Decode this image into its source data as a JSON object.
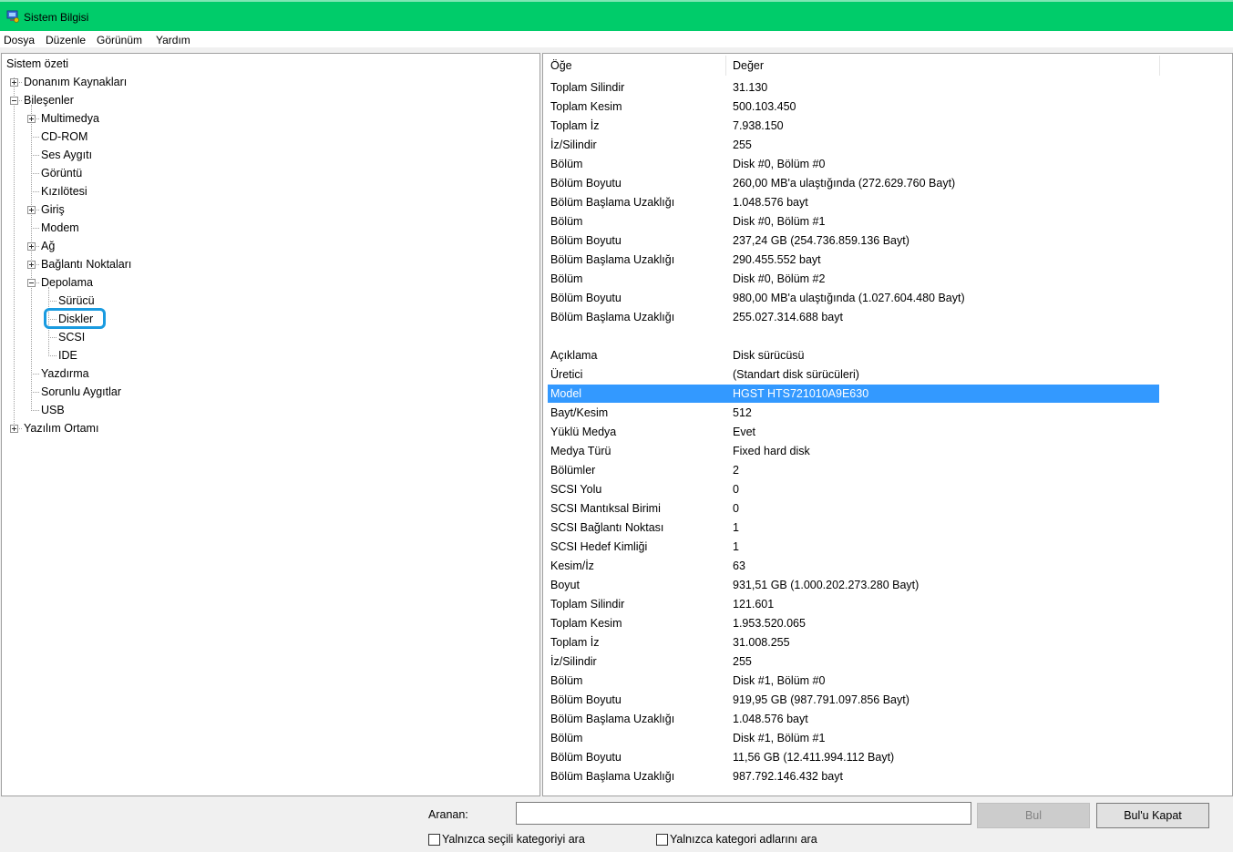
{
  "window": {
    "title": "Sistem Bilgisi",
    "icon": "system-info-icon"
  },
  "menu": [
    "Dosya",
    "Düzenle",
    "Görünüm",
    "Yardım"
  ],
  "tree": {
    "root": "Sistem özeti",
    "nodes": [
      {
        "label": "Donanım Kaynakları",
        "level": 1,
        "expander": "plus"
      },
      {
        "label": "Bileşenler",
        "level": 1,
        "expander": "minus"
      },
      {
        "label": "Multimedya",
        "level": 2,
        "expander": "plus"
      },
      {
        "label": "CD-ROM",
        "level": 2,
        "expander": "none"
      },
      {
        "label": "Ses Aygıtı",
        "level": 2,
        "expander": "none"
      },
      {
        "label": "Görüntü",
        "level": 2,
        "expander": "none"
      },
      {
        "label": "Kızılötesi",
        "level": 2,
        "expander": "none"
      },
      {
        "label": "Giriş",
        "level": 2,
        "expander": "plus"
      },
      {
        "label": "Modem",
        "level": 2,
        "expander": "none"
      },
      {
        "label": "Ağ",
        "level": 2,
        "expander": "plus"
      },
      {
        "label": "Bağlantı Noktaları",
        "level": 2,
        "expander": "plus"
      },
      {
        "label": "Depolama",
        "level": 2,
        "expander": "minus"
      },
      {
        "label": "Sürücü",
        "level": 3,
        "expander": "none"
      },
      {
        "label": "Diskler",
        "level": 3,
        "expander": "none",
        "selected": true
      },
      {
        "label": "SCSI",
        "level": 3,
        "expander": "none"
      },
      {
        "label": "IDE",
        "level": 3,
        "expander": "none"
      },
      {
        "label": "Yazdırma",
        "level": 2,
        "expander": "none"
      },
      {
        "label": "Sorunlu Aygıtlar",
        "level": 2,
        "expander": "none"
      },
      {
        "label": "USB",
        "level": 2,
        "expander": "none"
      },
      {
        "label": "Yazılım Ortamı",
        "level": 1,
        "expander": "plus"
      }
    ]
  },
  "list": {
    "columns": [
      "Öğe",
      "Değer"
    ],
    "selected_row": 17,
    "rows": [
      [
        "Toplam Silindir",
        "31.130"
      ],
      [
        "Toplam Kesim",
        "500.103.450"
      ],
      [
        "Toplam İz",
        "7.938.150"
      ],
      [
        "İz/Silindir",
        "255"
      ],
      [
        "Bölüm",
        "Disk #0, Bölüm #0"
      ],
      [
        "Bölüm Boyutu",
        "260,00 MB'a ulaştığında (272.629.760 Bayt)"
      ],
      [
        "Bölüm Başlama Uzaklığı",
        "1.048.576 bayt"
      ],
      [
        "Bölüm",
        "Disk #0, Bölüm #1"
      ],
      [
        "Bölüm Boyutu",
        "237,24 GB (254.736.859.136 Bayt)"
      ],
      [
        "Bölüm Başlama Uzaklığı",
        "290.455.552 bayt"
      ],
      [
        "Bölüm",
        "Disk #0, Bölüm #2"
      ],
      [
        "Bölüm Boyutu",
        "980,00 MB'a ulaştığında (1.027.604.480 Bayt)"
      ],
      [
        "Bölüm Başlama Uzaklığı",
        "255.027.314.688 bayt"
      ],
      [
        "",
        ""
      ],
      [
        "Açıklama",
        "Disk sürücüsü"
      ],
      [
        "Üretici",
        "(Standart disk sürücüleri)"
      ],
      [
        "Model",
        "HGST HTS721010A9E630"
      ],
      [
        "Bayt/Kesim",
        "512"
      ],
      [
        "Yüklü Medya",
        "Evet"
      ],
      [
        "Medya Türü",
        "Fixed hard disk"
      ],
      [
        "Bölümler",
        "2"
      ],
      [
        "SCSI Yolu",
        "0"
      ],
      [
        "SCSI Mantıksal Birimi",
        "0"
      ],
      [
        "SCSI Bağlantı Noktası",
        "1"
      ],
      [
        "SCSI Hedef Kimliği",
        "1"
      ],
      [
        "Kesim/İz",
        "63"
      ],
      [
        "Boyut",
        "931,51 GB (1.000.202.273.280 Bayt)"
      ],
      [
        "Toplam Silindir",
        "121.601"
      ],
      [
        "Toplam Kesim",
        "1.953.520.065"
      ],
      [
        "Toplam İz",
        "31.008.255"
      ],
      [
        "İz/Silindir",
        "255"
      ],
      [
        "Bölüm",
        "Disk #1, Bölüm #0"
      ],
      [
        "Bölüm Boyutu",
        "919,95 GB (987.791.097.856 Bayt)"
      ],
      [
        "Bölüm Başlama Uzaklığı",
        "1.048.576 bayt"
      ],
      [
        "Bölüm",
        "Disk #1, Bölüm #1"
      ],
      [
        "Bölüm Boyutu",
        "11,56 GB (12.411.994.112 Bayt)"
      ],
      [
        "Bölüm Başlama Uzaklığı",
        "987.792.146.432 bayt"
      ]
    ]
  },
  "search": {
    "label": "Aranan:",
    "value": "",
    "find_button": "Bul",
    "close_button": "Bul'u Kapat",
    "checkbox_selected_category": "Yalnızca seçili kategoriyi ara",
    "checkbox_category_names": "Yalnızca kategori adlarını ara",
    "checkbox_selected_category_checked": false,
    "checkbox_category_names_checked": false
  },
  "colors": {
    "titlebar": "#00cc6a",
    "selection": "#3399ff",
    "focus_ring": "#1a9be0"
  }
}
